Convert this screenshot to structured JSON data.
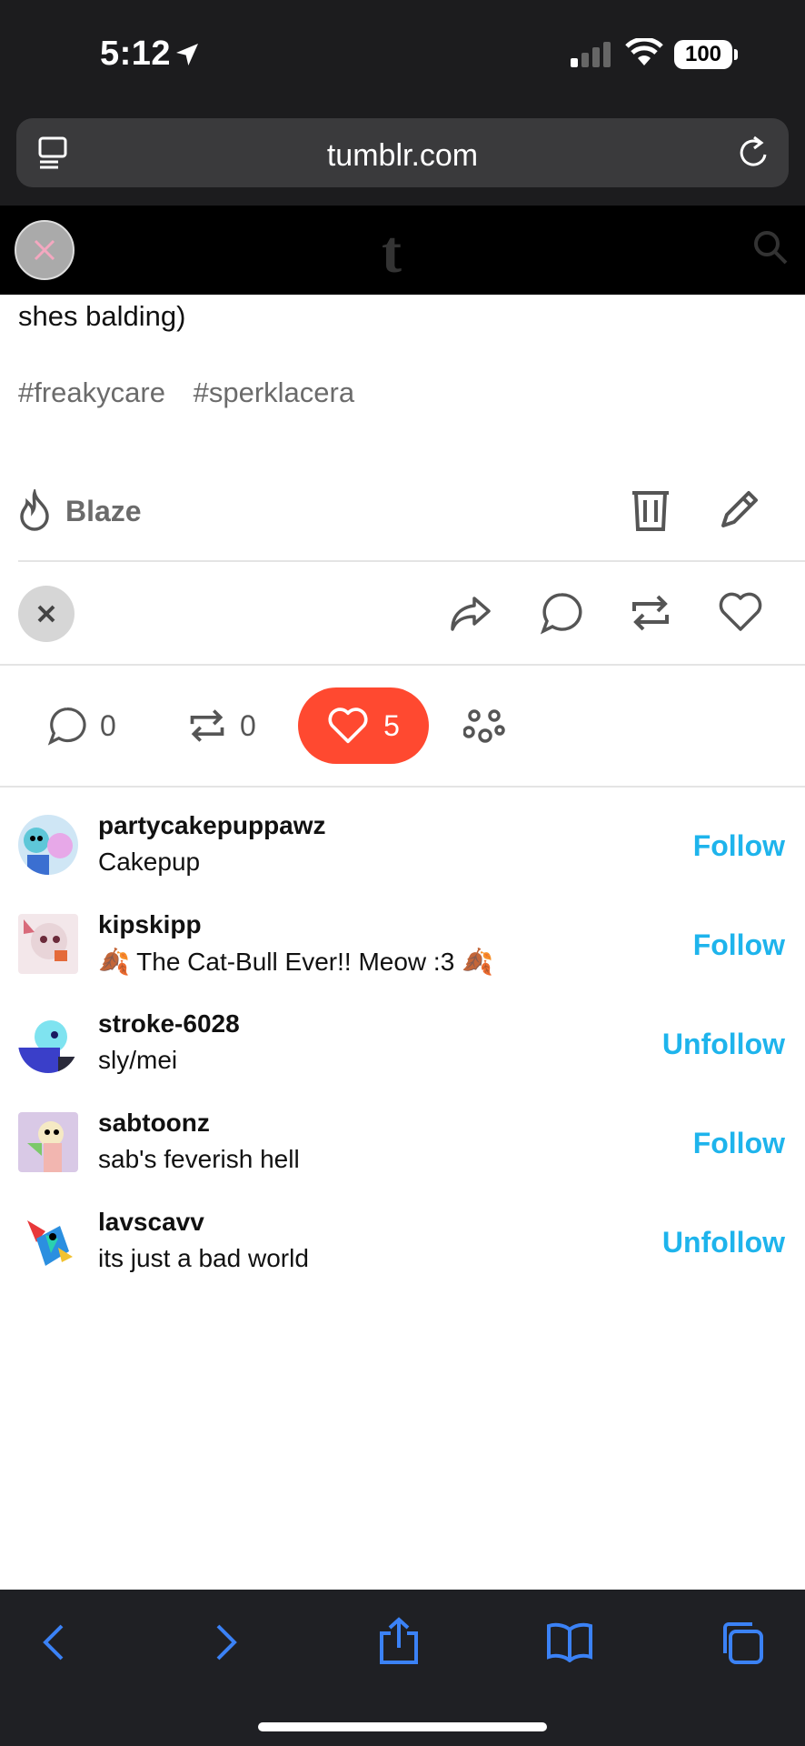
{
  "status_bar": {
    "time": "5:12",
    "battery": "100"
  },
  "browser": {
    "url": "tumblr.com"
  },
  "post": {
    "text": "shes balding)",
    "tags": [
      "#freakycare",
      "#sperklacera"
    ],
    "blaze_label": "Blaze"
  },
  "notes": {
    "replies_count": "0",
    "reblogs_count": "0",
    "likes_count": "5"
  },
  "likes": [
    {
      "username": "partycakepuppawz",
      "subtitle": "Cakepup",
      "action": "Follow"
    },
    {
      "username": "kipskipp",
      "subtitle": "🍂 The Cat-Bull Ever!! Meow :3 🍂",
      "action": "Follow"
    },
    {
      "username": "stroke-6028",
      "subtitle": "sly/mei",
      "action": "Unfollow"
    },
    {
      "username": "sabtoonz",
      "subtitle": "sab's feverish hell",
      "action": "Follow"
    },
    {
      "username": "lavscavv",
      "subtitle": "its just a bad world",
      "action": "Unfollow"
    }
  ],
  "colors": {
    "accent": "#1eb4ec",
    "like_active": "#ff4930",
    "header_bg": "#000000"
  }
}
